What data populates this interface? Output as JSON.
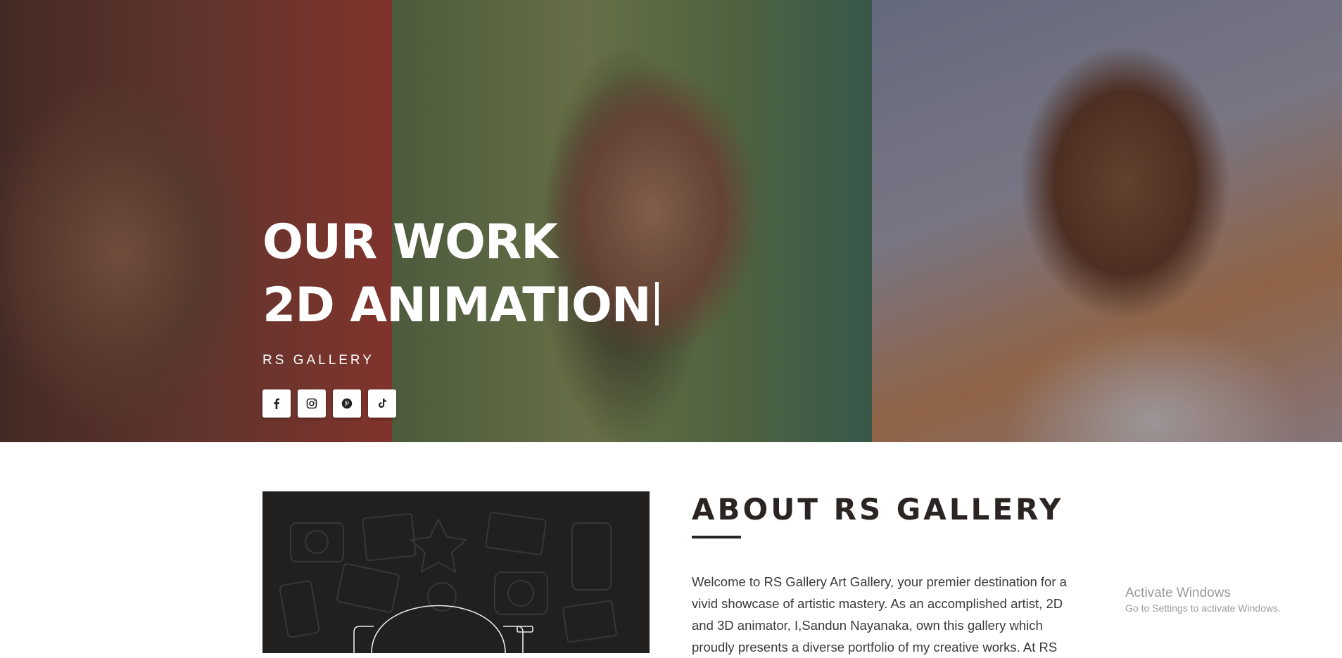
{
  "hero": {
    "line1": "OUR WORK",
    "line2": "2D ANIMATION",
    "subtitle": "RS GALLERY",
    "social": [
      {
        "name": "facebook-icon"
      },
      {
        "name": "instagram-icon"
      },
      {
        "name": "pinterest-icon"
      },
      {
        "name": "tiktok-icon"
      }
    ]
  },
  "about": {
    "title": "ABOUT RS GALLERY",
    "body": "Welcome to RS Gallery Art Gallery, your premier destination for a vivid showcase of artistic mastery. As an accomplished artist, 2D and 3D animator, I,Sandun Nayanaka, own this gallery which proudly presents a diverse portfolio of my creative works. At RS"
  },
  "watermark": {
    "title": "Activate Windows",
    "subtitle": "Go to Settings to activate Windows."
  },
  "colors": {
    "heading": "#2a2522",
    "image_bg": "#221f1f",
    "watermark": "#9a9a9a"
  }
}
